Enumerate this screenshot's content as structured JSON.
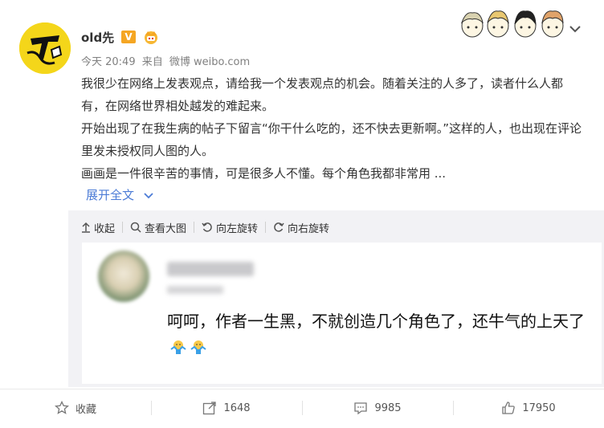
{
  "header": {
    "username": "old先",
    "verified_badge": "V",
    "crown_icon": "crown-icon",
    "time": "今天 20:49",
    "source_prefix": "来自",
    "source": "微博 weibo.com",
    "decorative_characters": "four-chibi-characters-icon",
    "menu_icon": "chevron-down-icon"
  },
  "post": {
    "paragraphs": [
      "我很少在网络上发表观点，请给我一个发表观点的机会。随着关注的人多了，读者什么人都有，在网络世界相处越发的难起来。",
      "开始出现了在我生病的帖子下留言“你干什么吃的，还不快去更新啊。”这样的人，也出现在评论里发未授权同人图的人。",
      "画画是一件很辛苦的事情，可是很多人不懂。每个角色我都非常用 ..."
    ],
    "expand_label": "展开全文"
  },
  "toolbar": {
    "collapse": "收起",
    "view_large": "查看大图",
    "rotate_left": "向左旋转",
    "rotate_right": "向右旋转"
  },
  "embedded": {
    "comment": "呵呵，作者一生黑，不就创造几个角色了，还牛气的上天了",
    "emoji": "shrug-emoji-icon"
  },
  "actions": {
    "favorite": "收藏",
    "repost": "1648",
    "comment": "9985",
    "like": "17950"
  },
  "colors": {
    "link": "#4b7bd6",
    "badge": "#f5a623",
    "panel_bg": "#f2f2f5"
  }
}
